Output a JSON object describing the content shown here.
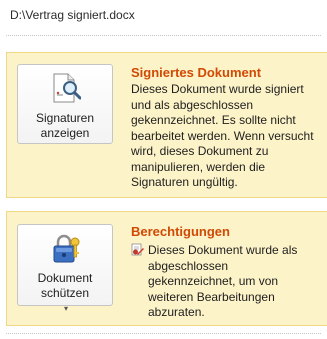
{
  "file": {
    "path": "D:\\Vertrag signiert.docx"
  },
  "signed_section": {
    "button": {
      "line1": "Signaturen",
      "line2": "anzeigen",
      "icon": "signature-document-magnifier-icon"
    },
    "title": "Signiertes Dokument",
    "description": "Dieses Dokument wurde signiert und als abgeschlossen gekennzeichnet. Es sollte nicht bearbeitet werden. Wenn versucht wird, dieses Dokument zu manipulieren, werden die Signaturen ungültig."
  },
  "permissions_section": {
    "button": {
      "line1": "Dokument",
      "line2": "schützen",
      "icon": "lock-key-icon",
      "caret": "▾"
    },
    "title": "Berechtigungen",
    "description_icon": "edit-restricted-icon",
    "description": "Dieses Dokument wurde als abgeschlossen gekennzeichnet, um von weiteren Bearbeitungen abzuraten."
  },
  "colors": {
    "section_background": "#fdf3c8",
    "section_border": "#efd786",
    "title_accent": "#d04a05"
  }
}
